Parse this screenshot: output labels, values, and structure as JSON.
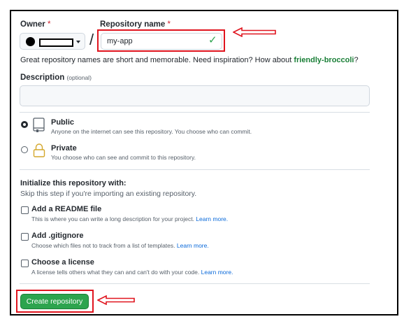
{
  "owner": {
    "label": "Owner",
    "required_mark": "*"
  },
  "repo": {
    "label": "Repository name",
    "required_mark": "*",
    "value": "my-app",
    "valid_icon": "check-icon"
  },
  "separator": "/",
  "hint": {
    "prefix": "Great repository names are short and memorable. Need inspiration? How about ",
    "suggestion": "friendly-broccoli",
    "suffix": "?"
  },
  "description": {
    "label": "Description",
    "optional": "(optional)",
    "value": ""
  },
  "visibility": {
    "public": {
      "title": "Public",
      "text": "Anyone on the internet can see this repository. You choose who can commit.",
      "selected": true
    },
    "private": {
      "title": "Private",
      "text": "You choose who can see and commit to this repository.",
      "selected": false
    }
  },
  "init": {
    "title": "Initialize this repository with:",
    "subtitle": "Skip this step if you're importing an existing repository.",
    "readme": {
      "title": "Add a README file",
      "text": "This is where you can write a long description for your project.",
      "link": "Learn more."
    },
    "gitignore": {
      "title": "Add .gitignore",
      "text": "Choose which files not to track from a list of templates.",
      "link": "Learn more."
    },
    "license": {
      "title": "Choose a license",
      "text": "A license tells others what they can and can't do with your code.",
      "link": "Learn more."
    }
  },
  "create_button": "Create repository",
  "colors": {
    "primary_button": "#2da44e",
    "highlight": "#e0141e",
    "link": "#0969da",
    "suggestion": "#1a7f37"
  }
}
